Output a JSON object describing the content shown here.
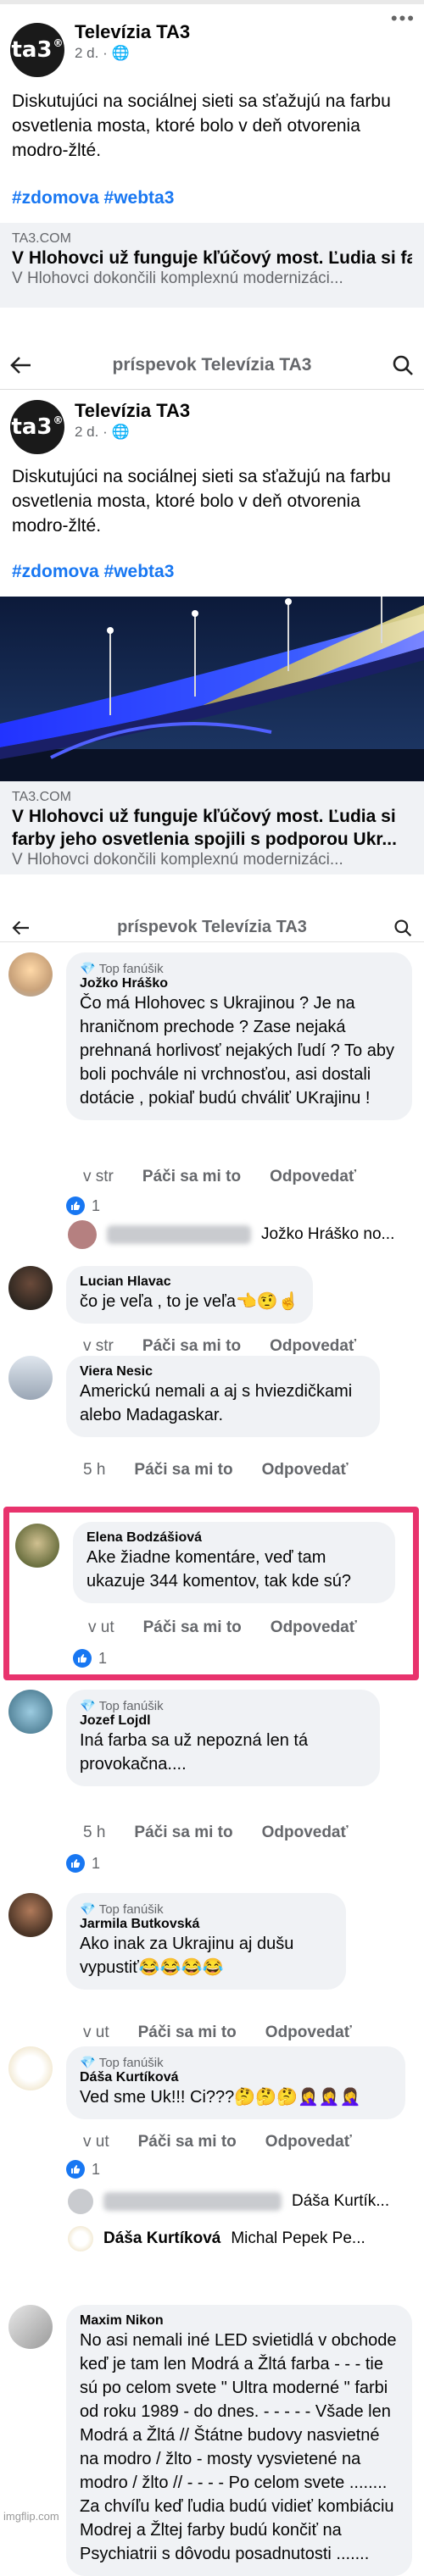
{
  "post1": {
    "page_name": "Televízia TA3",
    "time": "2 d. ·",
    "text": "Diskutujúci na sociálnej sieti sa sťažujú na farbu osvetlenia mosta, ktoré bolo v deň otvorenia modro-žlté.",
    "hashtags": "#zdomova #webta3",
    "link_source": "TA3.COM",
    "link_title": "V Hlohovci už funguje kľúčový most. Ľudia si farby jeho osvetlenia spojili s podporou Ukr...",
    "link_desc": "V Hlohovci dokončili komplexnú modernizáci..."
  },
  "header1": {
    "title": "príspevok Televízia TA3"
  },
  "post2": {
    "page_name": "Televízia TA3",
    "time": "2 d. ·",
    "text": "Diskutujúci na sociálnej sieti sa sťažujú na farbu osvetlenia mosta, ktoré bolo v deň otvorenia modro-žlté.",
    "hashtags": "#zdomova #webta3",
    "link_source": "TA3.COM",
    "link_title": "V Hlohovci už funguje kľúčový most. Ľudia si farby jeho osvetlenia spojili s podporou Ukr...",
    "link_desc": "V Hlohovci dokončili komplexnú modernizáci..."
  },
  "header2": {
    "title": "príspevok Televízia TA3"
  },
  "logo_text": "ta3",
  "labels": {
    "top_fan": "Top fanúšik",
    "like": "Páči sa mi to",
    "reply": "Odpovedať"
  },
  "comments": [
    {
      "name": "Jožko Hráško",
      "text": "Čo má Hlohovec s Ukrajinou ?  Je na hraničnom prechode ?  Zase nejaká prehnaná horlivosť nejakých ľudí ? To aby boli pochvále ni vrchnosťou, asi dostali dotácie ,  pokiaľ budú chváliť UKrajinu !",
      "time": "v str",
      "reactions": "1",
      "reply_name": "Jožko Hráško no..."
    },
    {
      "name": "Lucian Hlavac",
      "text": "čo je veľa , to je veľa👈🤨☝",
      "time": "v str"
    },
    {
      "name": "Viera Nesic",
      "text": "Americkú nemali a aj s hviezdičkami alebo Madagaskar.",
      "time": "5 h"
    },
    {
      "name": "Elena Bodzášiová",
      "text": "Ake žiadne komentáre, veď tam ukazuje 344 komentov, tak kde sú?",
      "time": "v ut",
      "reactions": "1"
    },
    {
      "name": "Jozef Lojdl",
      "text": "Iná farba sa už nepozná len tá provokačna....",
      "time": "5 h",
      "reactions": "1"
    },
    {
      "name": "Jarmila Butkovská",
      "text": "Ako inak za Ukrajinu aj dušu vypustiť😂😂😂😂",
      "time": "v ut"
    },
    {
      "name": "Dáša Kurtíková",
      "text": "Ved sme Uk!!! Ci???🤔🤔🤔🤦‍♀️🤦‍♀️🤦‍♀️",
      "time": "v ut",
      "reactions": "1",
      "reply1_name": "Dáša Kurtík...",
      "reply2_name": "Dáša Kurtíková",
      "reply2_text": "Michal Pepek Pe..."
    },
    {
      "name": "Maxim Nikon",
      "text": "No asi nemali iné LED svietidlá v obchode keď je tam len Modrá  a Žltá farba - - - tie sú po celom svete \" Ultra moderné \" farbi od roku 1989 - do dnes. - - - - - Všade len Modrá a Žltá // Štátne budovy nasvietné na modro / žlto - mosty vysvietené na modro / žlto // - - - - Po celom svete ........ Za chvíľu keď ľudia budú vidieť kombiáciu Modrej a Žltej farby budú končiť na Psychiatrii s dôvodu posadnutosti ......."
    }
  ],
  "watermark": "imgflip.com",
  "colors": {
    "highlight": "#e8336d",
    "link": "#1877f2",
    "bubble": "#f0f2f5",
    "meta": "#65676b"
  }
}
